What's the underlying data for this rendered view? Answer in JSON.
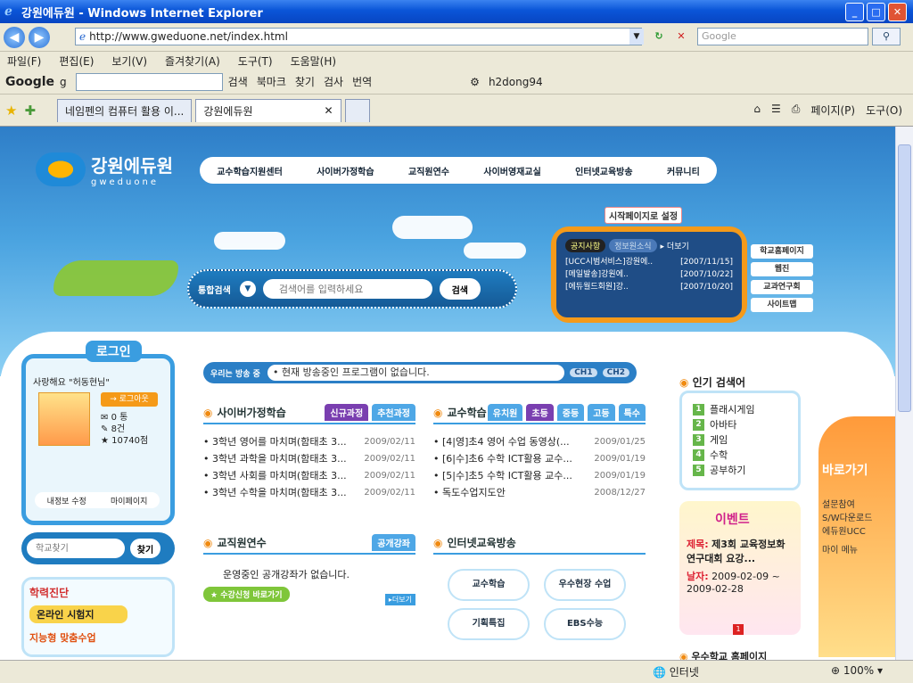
{
  "window": {
    "title": "강원에듀원 - Windows Internet Explorer"
  },
  "address": {
    "url": "http://www.gweduone.net/index.html",
    "search_placeholder": "Google"
  },
  "menu": [
    "파일(F)",
    "편집(E)",
    "보기(V)",
    "즐겨찾기(A)",
    "도구(T)",
    "도움말(H)"
  ],
  "gtoolbar": {
    "logo": "Google",
    "g_label": "g",
    "search": "검색",
    "bookmark": "북마크",
    "find": "찾기",
    "check": "검사",
    "translate": "번역",
    "user": "h2dong94"
  },
  "tabs": [
    {
      "label": "네임펜의 컴퓨터 활용 이..."
    },
    {
      "label": "강원에듀원"
    }
  ],
  "tab_tools": {
    "page": "페이지(P)",
    "tools": "도구(O)"
  },
  "status": {
    "zone": "인터넷",
    "zoom": "100%"
  },
  "site": {
    "logo_ko": "강원에듀원",
    "logo_en": "gweduone",
    "nav": [
      "교수학습지원센터",
      "사이버가정학습",
      "교직원연수",
      "사이버영재교실",
      "인터넷교육방송",
      "커뮤니티"
    ],
    "search": {
      "label": "통합검색",
      "placeholder": "검색어를 입력하세요",
      "button": "검색"
    },
    "start_page": "시작페이지로 설정",
    "notice": {
      "tab1": "공지사항",
      "tab2": "정보원소식",
      "more": "더보기",
      "items": [
        {
          "title": "[UCC시범서비스]강원에..",
          "date": "[2007/11/15]"
        },
        {
          "title": "[메일발송]강원에..",
          "date": "[2007/10/22]"
        },
        {
          "title": "[에듀월드회원]강..",
          "date": "[2007/10/20]"
        }
      ]
    },
    "side_links": [
      "학교홈페이지",
      "웹진",
      "교과연구회",
      "사이트맵"
    ],
    "login": {
      "title": "로그인",
      "greeting": "사랑해요 \"허동현님\"",
      "logout": "로그아웃",
      "counts": [
        "0 통",
        "8건",
        "10740점"
      ],
      "edit": "내정보 수정",
      "mypage": "마이페이지"
    },
    "school_search": {
      "placeholder": "학교찾기",
      "button": "찾기"
    },
    "diag": {
      "title": "학력진단",
      "online": "온라인 시험지",
      "custom": "지능형 맞춤수업"
    },
    "broadcast": {
      "label": "우리는 방송 중",
      "text": "• 현재 방송중인 프로그램이 없습니다.",
      "ch1": "CH1",
      "ch2": "CH2"
    },
    "cyber_home": {
      "title": "사이버가정학습",
      "tabs": [
        "신규과정",
        "추천과정"
      ],
      "posts": [
        {
          "title": "• 3학년 영어를 마치며(함태초 3...",
          "date": "2009/02/11"
        },
        {
          "title": "• 3학년 과학을 마치며(함태초 3...",
          "date": "2009/02/11"
        },
        {
          "title": "• 3학년 사회를 마치며(함태초 3...",
          "date": "2009/02/11"
        },
        {
          "title": "• 3학년 수학을 마치며(함태초 3...",
          "date": "2009/02/11"
        }
      ]
    },
    "teach": {
      "title": "교수학습",
      "tabs": [
        "유치원",
        "초등",
        "중등",
        "고등",
        "특수"
      ],
      "posts": [
        {
          "title": "• [4|영]초4 영어 수업 동영상(...",
          "date": "2009/01/25"
        },
        {
          "title": "• [6|수]초6 수학 ICT활용 교수...",
          "date": "2009/01/19"
        },
        {
          "title": "• [5|수]초5 수학 ICT활용 교수...",
          "date": "2009/01/19"
        },
        {
          "title": "• 독도수업지도안",
          "date": "2008/12/27"
        }
      ]
    },
    "training": {
      "title": "교직원연수",
      "tab": "공개강좌",
      "empty": "운영중인 공개강좌가 없습니다.",
      "apply": "수강신청 바로가기",
      "more": "더보기"
    },
    "broadcast_edu": {
      "title": "인터넷교육방송",
      "buttons": [
        "교수학습",
        "우수현장 수업",
        "기획특집",
        "EBS수능"
      ]
    },
    "popular": {
      "title": "인기 검색어",
      "items": [
        "플래시게임",
        "아바타",
        "게임",
        "수학",
        "공부하기"
      ]
    },
    "event": {
      "badge_text": "이벤트",
      "title_label": "제목:",
      "title": "제3회 교육정보화연구대회 요강...",
      "date_label": "날자:",
      "date": "2009-02-09 ~ 2009-02-28",
      "page": "1"
    },
    "school_home": "우수학교 홈페이지",
    "right_ad": {
      "title": "바로가기",
      "lines": [
        "설문참여",
        "S/W다운로드",
        "에듀원UCC",
        "마이 메뉴"
      ]
    }
  }
}
